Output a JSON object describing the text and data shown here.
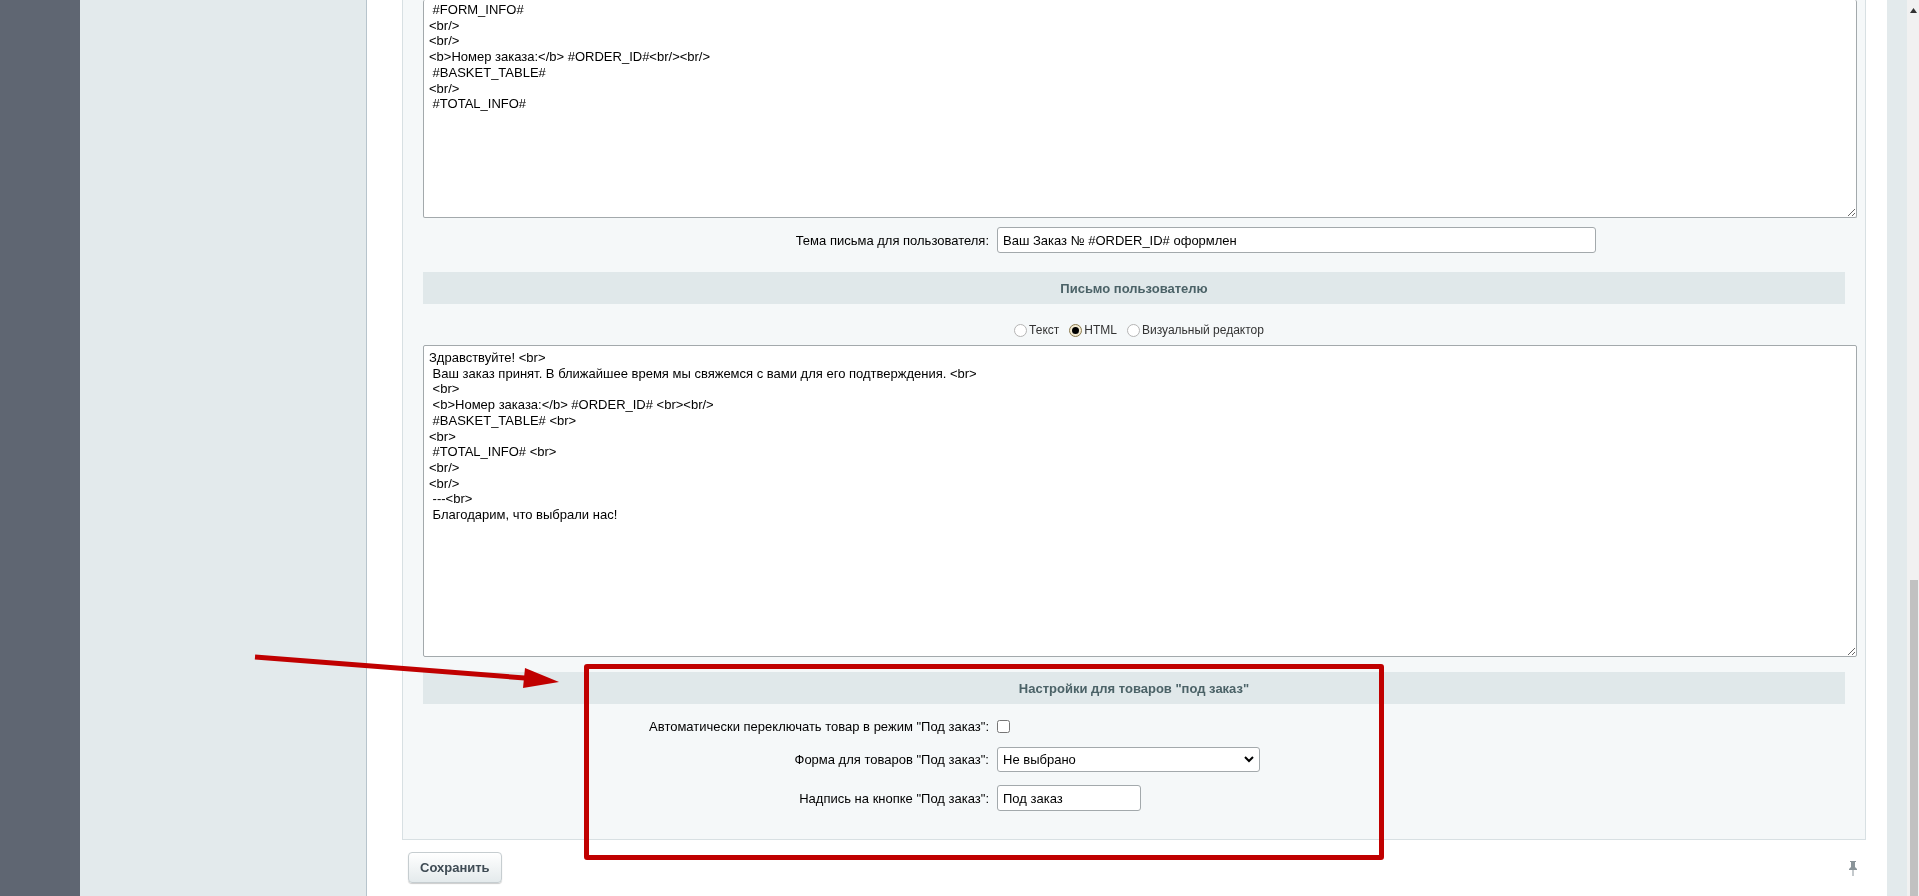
{
  "top_editor": {
    "lines": [
      " #FORM_INFO#",
      "<br/>",
      "<br/>",
      "<b>Номер заказа:</b> #ORDER_ID#<br/><br/>",
      " #BASKET_TABLE#",
      "<br/>",
      " #TOTAL_INFO#"
    ]
  },
  "subject": {
    "label": "Тема письма для пользователя:",
    "value": "Ваш Заказ № #ORDER_ID# оформлен"
  },
  "user_letter": {
    "title": "Письмо пользователю",
    "formats": [
      {
        "label": "Текст",
        "selected": false
      },
      {
        "label": "HTML",
        "selected": true
      },
      {
        "label": "Визуальный редактор",
        "selected": false
      }
    ],
    "lines": [
      "Здравствуйте! <br>",
      " Ваш заказ принят. В ближайшее время мы свяжемся с вами для его подтверждения. <br>",
      " <br>",
      " <b>Номер заказа:</b> #ORDER_ID# <br><br/>",
      " #BASKET_TABLE# <br>",
      "<br>",
      " #TOTAL_INFO# <br>",
      "<br/>",
      "<br/>",
      " ---<br>",
      " Благодарим, что выбрали нас!"
    ]
  },
  "preorder": {
    "title": "Настройки для товаров \"под заказ\"",
    "fields": [
      {
        "kind": "checkbox",
        "label": "Автоматически переключать товар в режим \"Под заказ\":",
        "checked": false
      },
      {
        "kind": "select",
        "label": "Форма для товаров \"Под заказ\":",
        "value": "Не выбрано"
      },
      {
        "kind": "text",
        "label": "Надпись на кнопке \"Под заказ\":",
        "value": "Под заказ"
      }
    ]
  },
  "save_button": "Сохранить"
}
